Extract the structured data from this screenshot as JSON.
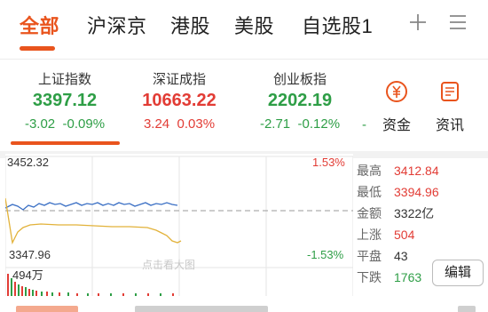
{
  "tabs": [
    {
      "label": "全部",
      "active": true
    },
    {
      "label": "沪深京"
    },
    {
      "label": "港股"
    },
    {
      "label": "美股"
    },
    {
      "label": "自选股1"
    }
  ],
  "toolbar_icons": [
    "add-icon",
    "menu-icon"
  ],
  "indices": [
    {
      "name": "上证指数",
      "value": "3397.12",
      "change": "-3.02",
      "percent": "-0.09%",
      "color": "#2e9e46"
    },
    {
      "name": "深证成指",
      "value": "10663.22",
      "change": "3.24",
      "percent": "0.03%",
      "color": "#e23c35"
    },
    {
      "name": "创业板指",
      "value": "2202.19",
      "change": "-2.71",
      "percent": "-0.12%",
      "color": "#2e9e46"
    }
  ],
  "more_dash": "-",
  "side_buttons": [
    {
      "label": "资金",
      "icon": "yuan-coin-icon"
    },
    {
      "label": "资讯",
      "icon": "news-icon"
    }
  ],
  "chart": {
    "high_label": "3452.32",
    "low_label": "3347.96",
    "high_pct": "1.53%",
    "low_pct": "-1.53%",
    "volume_label": "494万",
    "watermark": "点击看大图"
  },
  "chart_data": {
    "type": "line",
    "series": [],
    "ylim": [
      3347.96,
      3452.32
    ]
  },
  "stats": [
    {
      "label": "最高",
      "value": "3412.84",
      "color": "#e23c35"
    },
    {
      "label": "最低",
      "value": "3394.96",
      "color": "#e23c35"
    },
    {
      "label": "金额",
      "value": "3322亿",
      "color": "#333333"
    },
    {
      "label": "上涨",
      "value": "504",
      "color": "#e23c35"
    },
    {
      "label": "平盘",
      "value": "43",
      "color": "#333333"
    },
    {
      "label": "下跌",
      "value": "1763",
      "color": "#2e9e46"
    }
  ],
  "edit_label": "编辑",
  "colors": {
    "accent": "#e9541d",
    "up": "#e23c35",
    "down": "#2e9e46"
  }
}
